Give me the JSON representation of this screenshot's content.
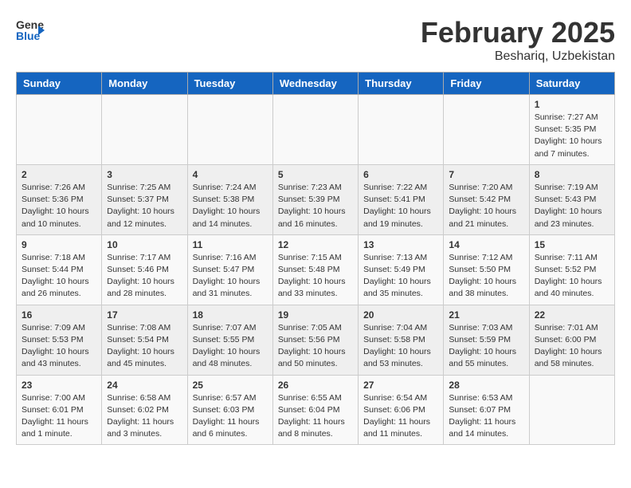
{
  "header": {
    "logo_general": "General",
    "logo_blue": "Blue",
    "month_title": "February 2025",
    "location": "Beshariq, Uzbekistan"
  },
  "days_of_week": [
    "Sunday",
    "Monday",
    "Tuesday",
    "Wednesday",
    "Thursday",
    "Friday",
    "Saturday"
  ],
  "weeks": [
    [
      {
        "day": "",
        "info": ""
      },
      {
        "day": "",
        "info": ""
      },
      {
        "day": "",
        "info": ""
      },
      {
        "day": "",
        "info": ""
      },
      {
        "day": "",
        "info": ""
      },
      {
        "day": "",
        "info": ""
      },
      {
        "day": "1",
        "info": "Sunrise: 7:27 AM\nSunset: 5:35 PM\nDaylight: 10 hours\nand 7 minutes."
      }
    ],
    [
      {
        "day": "2",
        "info": "Sunrise: 7:26 AM\nSunset: 5:36 PM\nDaylight: 10 hours\nand 10 minutes."
      },
      {
        "day": "3",
        "info": "Sunrise: 7:25 AM\nSunset: 5:37 PM\nDaylight: 10 hours\nand 12 minutes."
      },
      {
        "day": "4",
        "info": "Sunrise: 7:24 AM\nSunset: 5:38 PM\nDaylight: 10 hours\nand 14 minutes."
      },
      {
        "day": "5",
        "info": "Sunrise: 7:23 AM\nSunset: 5:39 PM\nDaylight: 10 hours\nand 16 minutes."
      },
      {
        "day": "6",
        "info": "Sunrise: 7:22 AM\nSunset: 5:41 PM\nDaylight: 10 hours\nand 19 minutes."
      },
      {
        "day": "7",
        "info": "Sunrise: 7:20 AM\nSunset: 5:42 PM\nDaylight: 10 hours\nand 21 minutes."
      },
      {
        "day": "8",
        "info": "Sunrise: 7:19 AM\nSunset: 5:43 PM\nDaylight: 10 hours\nand 23 minutes."
      }
    ],
    [
      {
        "day": "9",
        "info": "Sunrise: 7:18 AM\nSunset: 5:44 PM\nDaylight: 10 hours\nand 26 minutes."
      },
      {
        "day": "10",
        "info": "Sunrise: 7:17 AM\nSunset: 5:46 PM\nDaylight: 10 hours\nand 28 minutes."
      },
      {
        "day": "11",
        "info": "Sunrise: 7:16 AM\nSunset: 5:47 PM\nDaylight: 10 hours\nand 31 minutes."
      },
      {
        "day": "12",
        "info": "Sunrise: 7:15 AM\nSunset: 5:48 PM\nDaylight: 10 hours\nand 33 minutes."
      },
      {
        "day": "13",
        "info": "Sunrise: 7:13 AM\nSunset: 5:49 PM\nDaylight: 10 hours\nand 35 minutes."
      },
      {
        "day": "14",
        "info": "Sunrise: 7:12 AM\nSunset: 5:50 PM\nDaylight: 10 hours\nand 38 minutes."
      },
      {
        "day": "15",
        "info": "Sunrise: 7:11 AM\nSunset: 5:52 PM\nDaylight: 10 hours\nand 40 minutes."
      }
    ],
    [
      {
        "day": "16",
        "info": "Sunrise: 7:09 AM\nSunset: 5:53 PM\nDaylight: 10 hours\nand 43 minutes."
      },
      {
        "day": "17",
        "info": "Sunrise: 7:08 AM\nSunset: 5:54 PM\nDaylight: 10 hours\nand 45 minutes."
      },
      {
        "day": "18",
        "info": "Sunrise: 7:07 AM\nSunset: 5:55 PM\nDaylight: 10 hours\nand 48 minutes."
      },
      {
        "day": "19",
        "info": "Sunrise: 7:05 AM\nSunset: 5:56 PM\nDaylight: 10 hours\nand 50 minutes."
      },
      {
        "day": "20",
        "info": "Sunrise: 7:04 AM\nSunset: 5:58 PM\nDaylight: 10 hours\nand 53 minutes."
      },
      {
        "day": "21",
        "info": "Sunrise: 7:03 AM\nSunset: 5:59 PM\nDaylight: 10 hours\nand 55 minutes."
      },
      {
        "day": "22",
        "info": "Sunrise: 7:01 AM\nSunset: 6:00 PM\nDaylight: 10 hours\nand 58 minutes."
      }
    ],
    [
      {
        "day": "23",
        "info": "Sunrise: 7:00 AM\nSunset: 6:01 PM\nDaylight: 11 hours\nand 1 minute."
      },
      {
        "day": "24",
        "info": "Sunrise: 6:58 AM\nSunset: 6:02 PM\nDaylight: 11 hours\nand 3 minutes."
      },
      {
        "day": "25",
        "info": "Sunrise: 6:57 AM\nSunset: 6:03 PM\nDaylight: 11 hours\nand 6 minutes."
      },
      {
        "day": "26",
        "info": "Sunrise: 6:55 AM\nSunset: 6:04 PM\nDaylight: 11 hours\nand 8 minutes."
      },
      {
        "day": "27",
        "info": "Sunrise: 6:54 AM\nSunset: 6:06 PM\nDaylight: 11 hours\nand 11 minutes."
      },
      {
        "day": "28",
        "info": "Sunrise: 6:53 AM\nSunset: 6:07 PM\nDaylight: 11 hours\nand 14 minutes."
      },
      {
        "day": "",
        "info": ""
      }
    ]
  ]
}
